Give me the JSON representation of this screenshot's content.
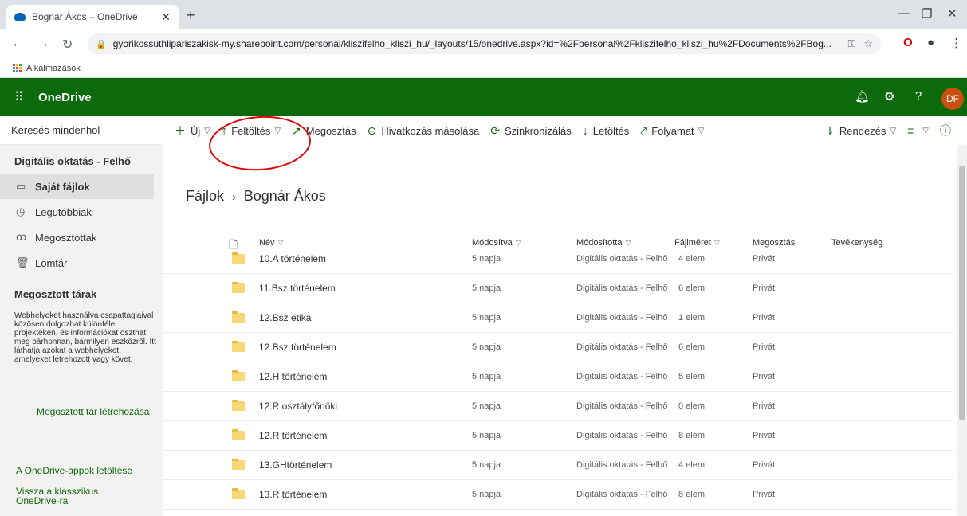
{
  "browser": {
    "tab_title": "Bognár Ákos – OneDrive",
    "url": "gyorikossuthlipariszakisk-my.sharepoint.com/personal/kliszifelho_kliszi_hu/_layouts/15/onedrive.aspx?id=%2Fpersonal%2Fkliszifelho_kliszi_hu%2FDocuments%2FBog...",
    "bookmarks_label": "Alkalmazások"
  },
  "suitebar": {
    "app_name": "OneDrive",
    "avatar_initials": "DF",
    "help_label": "?"
  },
  "leftnav": {
    "search_placeholder": "Keresés mindenhol",
    "site_name": "Digitális oktatás - Felhő",
    "items": [
      {
        "label": "Saját fájlok",
        "icon": "folder-icon"
      },
      {
        "label": "Legutóbbiak",
        "icon": "clock-icon"
      },
      {
        "label": "Megosztottak",
        "icon": "people-icon"
      },
      {
        "label": "Lomtár",
        "icon": "trash-icon"
      }
    ],
    "shared_section_title": "Megosztott tárak",
    "shared_description": "Webhelyeket használva csapattagjaival közösen dolgozhat különféle projekteken, és információkat oszthat meg bárhonnan, bármilyen eszközről. Itt láthatja azokat a webhelyeket, amelyeket létrehozott vagy követ.",
    "create_shared_link": "Megosztott tár létrehozása",
    "download_apps_link": "A OneDrive-appok letöltése",
    "classic_link": "Vissza a klasszikus OneDrive-ra"
  },
  "commandbar": {
    "new_label": "Új",
    "upload_label": "Feltöltés",
    "share_label": "Megosztás",
    "copy_link_label": "Hivatkozás másolása",
    "sync_label": "Szinkronizálás",
    "download_label": "Letöltés",
    "flow_label": "Folyamat",
    "sort_label": "Rendezés"
  },
  "breadcrumb": {
    "root": "Fájlok",
    "current": "Bognár Ákos"
  },
  "table": {
    "headers": {
      "name": "Név",
      "modified": "Módosítva",
      "modified_by": "Módosította",
      "size": "Fájlméret",
      "sharing": "Megosztás",
      "activity": "Tevékenység"
    },
    "rows": [
      {
        "name": "10.A történelem",
        "modified": "5 napja",
        "modified_by": "Digitális oktatás - Felhő",
        "size": "4 elem",
        "sharing": "Privát"
      },
      {
        "name": "11.Bsz történelem",
        "modified": "5 napja",
        "modified_by": "Digitális oktatás - Felhő",
        "size": "6 elem",
        "sharing": "Privát"
      },
      {
        "name": "12.Bsz etika",
        "modified": "5 napja",
        "modified_by": "Digitális oktatás - Felhő",
        "size": "1 elem",
        "sharing": "Privát"
      },
      {
        "name": "12.Bsz történelem",
        "modified": "5 napja",
        "modified_by": "Digitális oktatás - Felhő",
        "size": "6 elem",
        "sharing": "Privát"
      },
      {
        "name": "12.H történelem",
        "modified": "5 napja",
        "modified_by": "Digitális oktatás - Felhő",
        "size": "5 elem",
        "sharing": "Privát"
      },
      {
        "name": "12.R osztályfőnöki",
        "modified": "5 napja",
        "modified_by": "Digitális oktatás - Felhő",
        "size": "0 elem",
        "sharing": "Privát"
      },
      {
        "name": "12.R történelem",
        "modified": "5 napja",
        "modified_by": "Digitális oktatás - Felhő",
        "size": "8 elem",
        "sharing": "Privát"
      },
      {
        "name": "13.GHtörténelem",
        "modified": "5 napja",
        "modified_by": "Digitális oktatás - Felhő",
        "size": "4 elem",
        "sharing": "Privát"
      },
      {
        "name": "13.R történelem",
        "modified": "5 napja",
        "modified_by": "Digitális oktatás - Felhő",
        "size": "8 elem",
        "sharing": "Privát"
      }
    ]
  },
  "colors": {
    "brand_green": "#0b6a0b",
    "avatar": "#ca5010",
    "annotation_circle": "#e00000"
  }
}
